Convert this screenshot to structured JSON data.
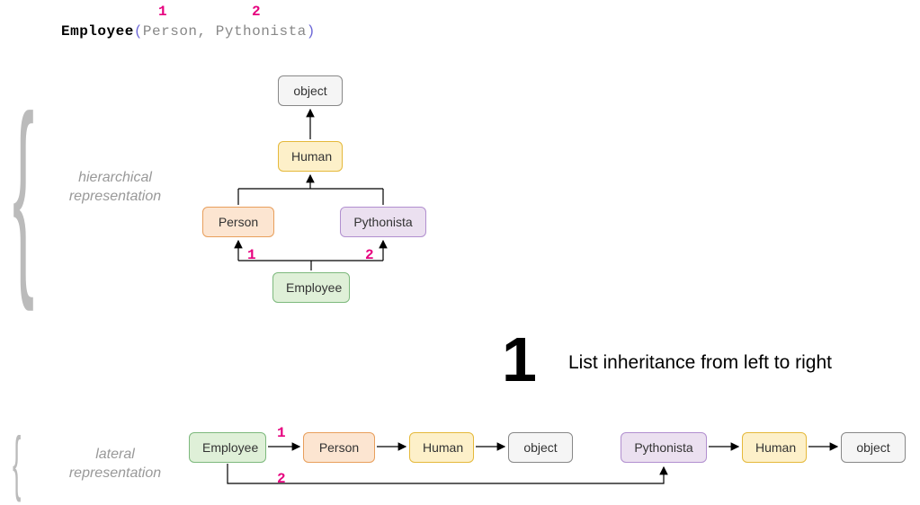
{
  "code": {
    "class_name": "Employee",
    "paren_open": "(",
    "arg1": "Person",
    "comma": ",",
    "arg2": "Pythonista",
    "paren_close": ")",
    "marker1": "1",
    "marker2": "2"
  },
  "labels": {
    "hierarchical_l1": "hierarchical",
    "hierarchical_l2": "representation",
    "lateral_l1": "lateral",
    "lateral_l2": "representation"
  },
  "step": {
    "number": "1",
    "text": "List inheritance from left to right"
  },
  "nodes": {
    "object": "object",
    "human": "Human",
    "person": "Person",
    "pythonista": "Pythonista",
    "employee": "Employee"
  },
  "markers": {
    "h1": "1",
    "h2": "2",
    "l1": "1",
    "l2": "2"
  },
  "chart_data": {
    "type": "inheritance-diagram",
    "class_declaration": "Employee(Person, Pythonista)",
    "inheritance_order": [
      "Person",
      "Pythonista"
    ],
    "hierarchical": {
      "nodes": [
        "object",
        "Human",
        "Person",
        "Pythonista",
        "Employee"
      ],
      "edges": [
        {
          "from": "Human",
          "to": "object"
        },
        {
          "from": "Person",
          "to": "Human"
        },
        {
          "from": "Pythonista",
          "to": "Human"
        },
        {
          "from": "Employee",
          "to": "Person",
          "order": 1
        },
        {
          "from": "Employee",
          "to": "Pythonista",
          "order": 2
        }
      ]
    },
    "lateral": {
      "chains": [
        [
          "Employee",
          "Person",
          "Human",
          "object"
        ],
        [
          "Employee",
          "Pythonista",
          "Human",
          "object"
        ]
      ],
      "edge_labels": [
        {
          "from": "Employee",
          "to": "Person",
          "order": 1
        },
        {
          "from": "Employee",
          "to": "Pythonista",
          "order": 2
        }
      ]
    },
    "caption": "List inheritance from left to right"
  }
}
